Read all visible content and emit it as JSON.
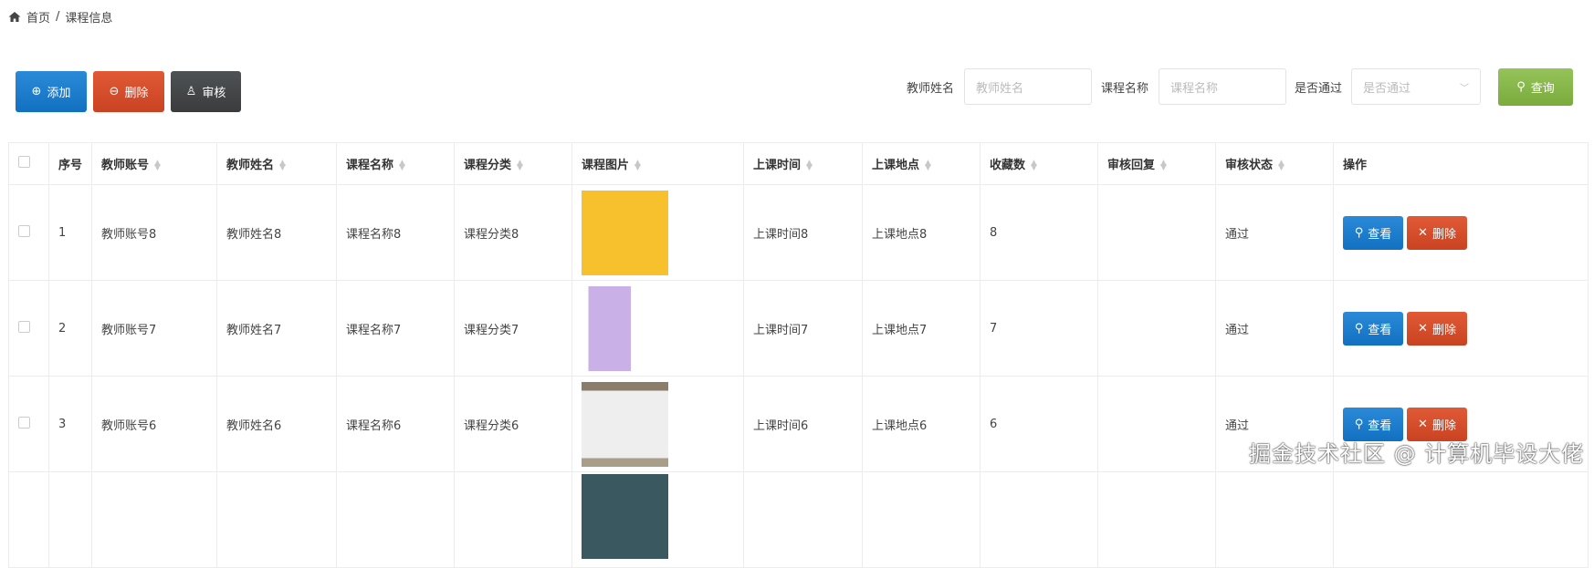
{
  "breadcrumb": {
    "home": "首页",
    "separator": "/",
    "current": "课程信息"
  },
  "toolbar": {
    "add": "添加",
    "delete": "删除",
    "audit": "审核"
  },
  "search": {
    "teacher_label": "教师姓名",
    "teacher_placeholder": "教师姓名",
    "course_label": "课程名称",
    "course_placeholder": "课程名称",
    "pass_label": "是否通过",
    "pass_placeholder": "是否通过",
    "query": "查询"
  },
  "table": {
    "headers": [
      "序号",
      "教师账号",
      "教师姓名",
      "课程名称",
      "课程分类",
      "课程图片",
      "上课时间",
      "上课地点",
      "收藏数",
      "审核回复",
      "审核状态",
      "操作"
    ],
    "rows": [
      {
        "index": "1",
        "account": "教师账号8",
        "name": "教师姓名8",
        "course": "课程名称8",
        "category": "课程分类8",
        "time": "上课时间8",
        "place": "上课地点8",
        "favorites": "8",
        "reply": "",
        "status": "通过"
      },
      {
        "index": "2",
        "account": "教师账号7",
        "name": "教师姓名7",
        "course": "课程名称7",
        "category": "课程分类7",
        "time": "上课时间7",
        "place": "上课地点7",
        "favorites": "7",
        "reply": "",
        "status": "通过"
      },
      {
        "index": "3",
        "account": "教师账号6",
        "name": "教师姓名6",
        "course": "课程名称6",
        "category": "课程分类6",
        "time": "上课时间6",
        "place": "上课地点6",
        "favorites": "6",
        "reply": "",
        "status": "通过"
      }
    ],
    "view": "查看",
    "delete": "删除"
  },
  "watermark": "掘金技术社区 @ 计算机毕设大佬"
}
